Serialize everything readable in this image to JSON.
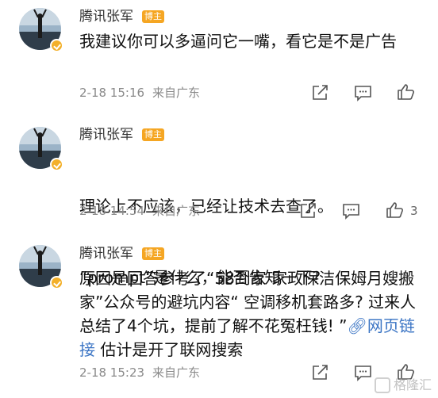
{
  "comments": [
    {
      "author": "腾讯张军",
      "badge": "博主",
      "text": "我建议你可以多逼问它一嘴，看它是不是广告",
      "date": "2-18 15:16",
      "location": "来自广东",
      "likes": ""
    },
    {
      "author": "腾讯张军",
      "badge": "博主",
      "text_lines": [
        "理论上不应该，已经让技术去查了。",
        "“prompt”是什么，能否告知一下?"
      ],
      "date": "2-18 14:54",
      "location": "来自广东",
      "likes": "3"
    },
    {
      "author": "腾讯张军",
      "badge": "博主",
      "text_before": "原因是回答参考了“58到家 家政保洁保姆月嫂搬家”公众号的避坑内容“ 空调移机套路多? 过来人总结了4个坑，提前了解不花冤枉钱! ”",
      "link_text": "网页链接",
      "text_after": " 估计是开了联网搜索",
      "date": "2-18 15:23",
      "location": "来自广东",
      "likes": ""
    }
  ],
  "watermark": "格隆汇",
  "colors": {
    "badge": "#f5a623",
    "link": "#3a74c4",
    "meta": "#8a8a8a",
    "verified": "#f3b02a"
  },
  "icons": [
    "share-icon",
    "comment-icon",
    "like-icon",
    "verified-icon",
    "link-icon"
  ]
}
